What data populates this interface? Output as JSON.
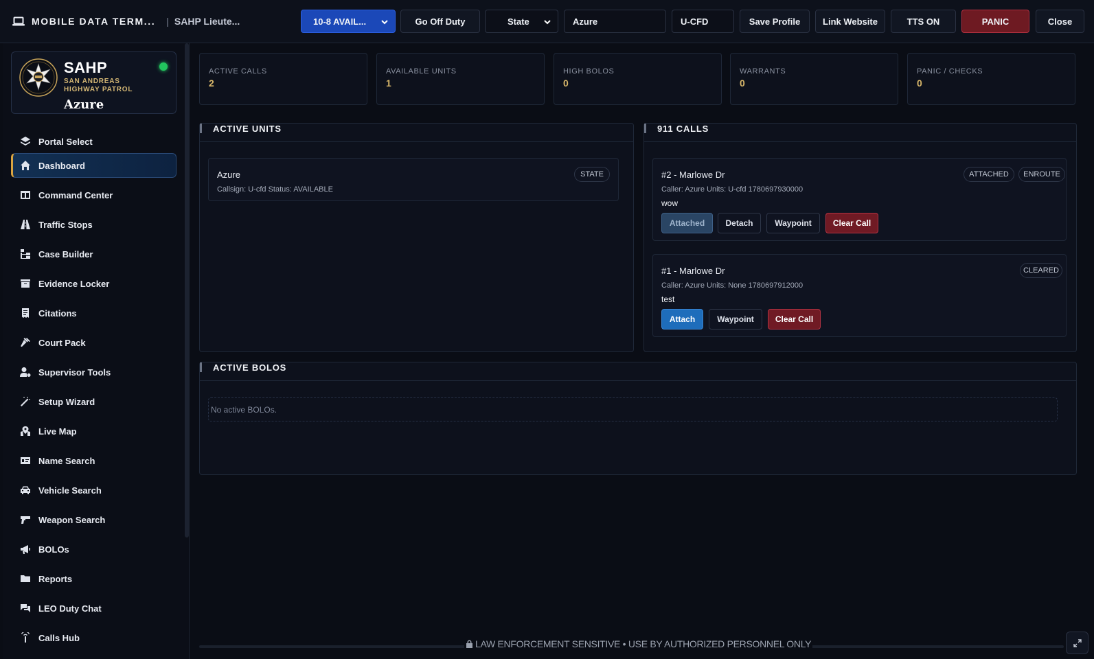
{
  "header": {
    "title": "MOBILE DATA TERM...",
    "separator": "|",
    "subtitle": "SAHP Lieute...",
    "status_select": "10-8 AVAIL...",
    "off_duty": "Go Off Duty",
    "department_select": "State",
    "name_value": "Azure",
    "callsign_value": "U-CFD",
    "save_profile": "Save Profile",
    "link_website": "Link Website",
    "tts": "TTS ON",
    "panic": "PANIC",
    "close": "Close"
  },
  "org": {
    "abbr": "SAHP",
    "full_name": "SAN ANDREAS HIGHWAY PATROL",
    "user": "Azure",
    "status_color": "#22c55e"
  },
  "sidebar": {
    "items": [
      {
        "label": "Portal Select",
        "icon": "layers-icon"
      },
      {
        "label": "Dashboard",
        "icon": "home-icon",
        "active": true
      },
      {
        "label": "Command Center",
        "icon": "columns-icon"
      },
      {
        "label": "Traffic Stops",
        "icon": "road-icon"
      },
      {
        "label": "Case Builder",
        "icon": "sitemap-icon"
      },
      {
        "label": "Evidence Locker",
        "icon": "archive-icon"
      },
      {
        "label": "Citations",
        "icon": "receipt-icon"
      },
      {
        "label": "Court Pack",
        "icon": "gavel-icon"
      },
      {
        "label": "Supervisor Tools",
        "icon": "user-gear-icon"
      },
      {
        "label": "Setup Wizard",
        "icon": "wand-icon"
      },
      {
        "label": "Live Map",
        "icon": "map-pin-icon"
      },
      {
        "label": "Name Search",
        "icon": "id-card-icon"
      },
      {
        "label": "Vehicle Search",
        "icon": "car-icon"
      },
      {
        "label": "Weapon Search",
        "icon": "gun-icon"
      },
      {
        "label": "BOLOs",
        "icon": "megaphone-icon"
      },
      {
        "label": "Reports",
        "icon": "folder-icon"
      },
      {
        "label": "LEO Duty Chat",
        "icon": "comments-icon"
      },
      {
        "label": "Calls Hub",
        "icon": "tower-icon"
      }
    ]
  },
  "stats": [
    {
      "label": "ACTIVE CALLS",
      "value": "2"
    },
    {
      "label": "AVAILABLE UNITS",
      "value": "1"
    },
    {
      "label": "HIGH BOLOS",
      "value": "0"
    },
    {
      "label": "WARRANTS",
      "value": "0"
    },
    {
      "label": "PANIC / CHECKS",
      "value": "0"
    }
  ],
  "active_units": {
    "title": "ACTIVE UNITS",
    "units": [
      {
        "name": "Azure",
        "meta": "Callsign: U-cfd  Status: AVAILABLE",
        "badge": "STATE"
      }
    ]
  },
  "calls": {
    "title": "911 CALLS",
    "items": [
      {
        "title": "#2 - Marlowe Dr",
        "meta": "Caller: Azure  Units: U-cfd    1780697930000",
        "desc": "wow",
        "badges": [
          "ATTACHED",
          "ENROUTE"
        ],
        "actions": [
          "Attached",
          "Detach",
          "Waypoint",
          "Clear Call"
        ]
      },
      {
        "title": "#1 - Marlowe Dr",
        "meta": "Caller: Azure  Units: None    1780697912000",
        "desc": "test",
        "badges": [
          "CLEARED"
        ],
        "actions": [
          "Attach",
          "Waypoint",
          "Clear Call"
        ]
      }
    ]
  },
  "bolos": {
    "title": "ACTIVE BOLOS",
    "empty": "No active BOLOs."
  },
  "footer": {
    "notice": "LAW ENFORCEMENT SENSITIVE • USE BY AUTHORIZED PERSONNEL ONLY"
  },
  "colors": {
    "accent_gold": "#d8b76a",
    "primary_blue": "#1b48b8",
    "danger_red": "#701a24"
  }
}
